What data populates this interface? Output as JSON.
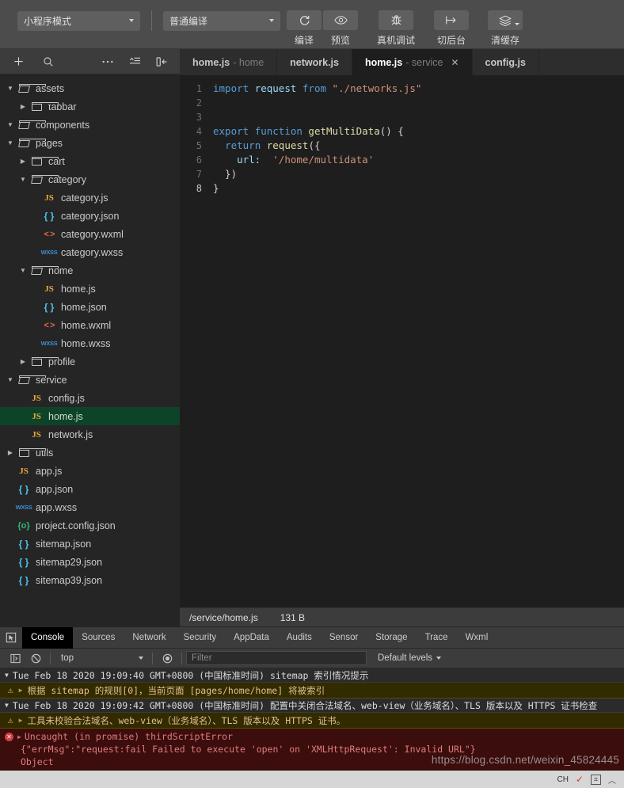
{
  "toolbar": {
    "mode_select": {
      "value": "小程序模式",
      "icon": "chevron-down-icon"
    },
    "compile_select": {
      "value": "普通编译",
      "icon": "chevron-down-icon"
    },
    "buttons": [
      {
        "label": "编译",
        "icon": "refresh-icon"
      },
      {
        "label": "预览",
        "icon": "eye-icon"
      },
      {
        "label": "真机调试",
        "icon": "bug-icon"
      },
      {
        "label": "切后台",
        "icon": "background-switch-icon"
      },
      {
        "label": "清缓存",
        "icon": "layers-icon"
      }
    ]
  },
  "sidebar": {
    "toolbar_icons": [
      {
        "name": "add-file-icon",
        "glyph": "+"
      },
      {
        "name": "search-icon",
        "glyph": "search"
      },
      {
        "name": "more-options-icon",
        "glyph": "…"
      },
      {
        "name": "collapse-all-icon",
        "glyph": "collapse"
      },
      {
        "name": "toggle-sidebar-icon",
        "glyph": "panel"
      }
    ],
    "tree": [
      {
        "label": "assets",
        "depth": 0,
        "kind": "folder",
        "state": "open",
        "selected": false
      },
      {
        "label": "tabbar",
        "depth": 1,
        "kind": "folder",
        "state": "closed",
        "selected": false
      },
      {
        "label": "components",
        "depth": 0,
        "kind": "folder",
        "state": "open",
        "selected": false
      },
      {
        "label": "pages",
        "depth": 0,
        "kind": "folder",
        "state": "open",
        "selected": false
      },
      {
        "label": "cart",
        "depth": 1,
        "kind": "folder",
        "state": "closed",
        "selected": false
      },
      {
        "label": "category",
        "depth": 1,
        "kind": "folder",
        "state": "open",
        "selected": false
      },
      {
        "label": "category.js",
        "depth": 2,
        "kind": "js",
        "selected": false
      },
      {
        "label": "category.json",
        "depth": 2,
        "kind": "json",
        "selected": false
      },
      {
        "label": "category.wxml",
        "depth": 2,
        "kind": "wxml",
        "selected": false
      },
      {
        "label": "category.wxss",
        "depth": 2,
        "kind": "wxss",
        "selected": false
      },
      {
        "label": "home",
        "depth": 1,
        "kind": "folder",
        "state": "open",
        "selected": false
      },
      {
        "label": "home.js",
        "depth": 2,
        "kind": "js",
        "selected": false
      },
      {
        "label": "home.json",
        "depth": 2,
        "kind": "json",
        "selected": false
      },
      {
        "label": "home.wxml",
        "depth": 2,
        "kind": "wxml",
        "selected": false
      },
      {
        "label": "home.wxss",
        "depth": 2,
        "kind": "wxss",
        "selected": false
      },
      {
        "label": "profile",
        "depth": 1,
        "kind": "folder",
        "state": "closed",
        "selected": false
      },
      {
        "label": "service",
        "depth": 0,
        "kind": "folder",
        "state": "open",
        "selected": false
      },
      {
        "label": "config.js",
        "depth": 1,
        "kind": "js",
        "selected": false
      },
      {
        "label": "home.js",
        "depth": 1,
        "kind": "js",
        "selected": true
      },
      {
        "label": "network.js",
        "depth": 1,
        "kind": "js",
        "selected": false
      },
      {
        "label": "utils",
        "depth": 0,
        "kind": "folder",
        "state": "closed",
        "selected": false
      },
      {
        "label": "app.js",
        "depth": 0,
        "kind": "js",
        "selected": false
      },
      {
        "label": "app.json",
        "depth": 0,
        "kind": "json",
        "selected": false
      },
      {
        "label": "app.wxss",
        "depth": 0,
        "kind": "wxss",
        "selected": false
      },
      {
        "label": "project.config.json",
        "depth": 0,
        "kind": "pjson",
        "selected": false
      },
      {
        "label": "sitemap.json",
        "depth": 0,
        "kind": "json",
        "selected": false
      },
      {
        "label": "sitemap29.json",
        "depth": 0,
        "kind": "json",
        "selected": false
      },
      {
        "label": "sitemap39.json",
        "depth": 0,
        "kind": "json",
        "selected": false
      }
    ]
  },
  "editor": {
    "tabs": [
      {
        "file": "home.js",
        "dir": "- home",
        "active": false,
        "closable": false
      },
      {
        "file": "network.js",
        "dir": "",
        "active": false,
        "closable": false
      },
      {
        "file": "home.js",
        "dir": "- service",
        "active": true,
        "closable": true,
        "close_icon": "close-icon"
      },
      {
        "file": "config.js",
        "dir": "",
        "active": false,
        "closable": false
      }
    ],
    "lines": [
      {
        "n": "1",
        "tokens": [
          {
            "t": "import ",
            "c": "import"
          },
          {
            "t": "request ",
            "c": "ident"
          },
          {
            "t": "from ",
            "c": "import"
          },
          {
            "t": "\"./networks.js\"",
            "c": "str"
          }
        ]
      },
      {
        "n": "2",
        "tokens": []
      },
      {
        "n": "3",
        "tokens": []
      },
      {
        "n": "4",
        "tokens": [
          {
            "t": "export ",
            "c": "import"
          },
          {
            "t": "function ",
            "c": "import"
          },
          {
            "t": "getMultiData",
            "c": "fn"
          },
          {
            "t": "() {",
            "c": "plain"
          }
        ]
      },
      {
        "n": "5",
        "tokens": [
          {
            "t": "  ",
            "c": "plain"
          },
          {
            "t": "return ",
            "c": "import"
          },
          {
            "t": "request",
            "c": "fn"
          },
          {
            "t": "({",
            "c": "plain"
          }
        ]
      },
      {
        "n": "6",
        "tokens": [
          {
            "t": "    ",
            "c": "plain"
          },
          {
            "t": "url:",
            "c": "ident"
          },
          {
            "t": "  ",
            "c": "plain"
          },
          {
            "t": "'/home/multidata'",
            "c": "str"
          }
        ]
      },
      {
        "n": "7",
        "tokens": [
          {
            "t": "  })",
            "c": "plain"
          }
        ]
      },
      {
        "n": "8",
        "tokens": [
          {
            "t": "}",
            "c": "plain"
          }
        ],
        "current": true
      }
    ],
    "status": {
      "path": "/service/home.js",
      "size": "131 B"
    }
  },
  "devtools": {
    "inspect_icon": "inspect-element-icon",
    "tabs": [
      {
        "label": "Console",
        "active": true
      },
      {
        "label": "Sources",
        "active": false
      },
      {
        "label": "Network",
        "active": false
      },
      {
        "label": "Security",
        "active": false
      },
      {
        "label": "AppData",
        "active": false
      },
      {
        "label": "Audits",
        "active": false
      },
      {
        "label": "Sensor",
        "active": false
      },
      {
        "label": "Storage",
        "active": false
      },
      {
        "label": "Trace",
        "active": false
      },
      {
        "label": "Wxml",
        "active": false
      }
    ],
    "filterbar": {
      "sidebar_icon": "console-sidebar-icon",
      "clear_icon": "clear-console-icon",
      "eye_icon": "live-expression-icon",
      "context": "top",
      "filter_placeholder": "Filter",
      "levels": "Default levels",
      "levels_caret": "chevron-down-icon"
    },
    "entries": [
      {
        "type": "group",
        "text": "Tue Feb 18 2020 19:09:40 GMT+0800 (中国标准时间) sitemap 索引情况提示",
        "tri": "▼"
      },
      {
        "type": "warning",
        "icon": "warning-icon",
        "tri": "▶",
        "text": "根据 sitemap 的规则[0]，当前页面 [pages/home/home] 将被索引"
      },
      {
        "type": "group",
        "text": "Tue Feb 18 2020 19:09:42 GMT+0800 (中国标准时间) 配置中关闭合法域名、web-view（业务域名）、TLS 版本以及 HTTPS 证书检查",
        "tri": "▼"
      },
      {
        "type": "warning",
        "icon": "warning-icon",
        "tri": "▶",
        "text": "工具未校验合法域名、web-view（业务域名）、TLS 版本以及 HTTPS 证书。"
      },
      {
        "type": "error",
        "icon": "error-icon",
        "tri": "▶",
        "lines": [
          "Uncaught (in promise) thirdScriptError",
          "{\"errMsg\":\"request:fail Failed to execute 'open' on 'XMLHttpRequest': Invalid URL\"}",
          "Object"
        ]
      }
    ],
    "prompt": ">"
  },
  "watermark": "https://blog.csdn.net/weixin_45824445",
  "taskbar": {
    "items": [
      {
        "name": "ime-language-indicator",
        "label": "CH"
      },
      {
        "name": "ime-pen-icon",
        "label": "✓"
      },
      {
        "name": "ime-keyboard-icon",
        "label": "⌗"
      },
      {
        "name": "show-hidden-icons-icon",
        "label": "︿"
      }
    ]
  }
}
